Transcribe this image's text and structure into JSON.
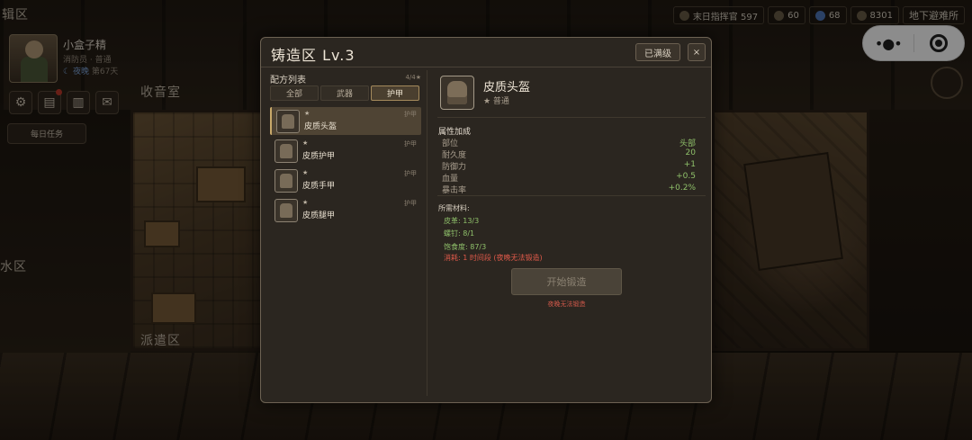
{
  "scene": {
    "room_labels": {
      "radio": "收音室",
      "dispatch": "派遣区",
      "water": "水区",
      "top_left": "辑区"
    }
  },
  "player": {
    "name": "小盒子精",
    "role": "消防员 · 普通",
    "period": "夜晚",
    "day": "第67天"
  },
  "hud": {
    "daily_tasks": "每日任务",
    "icons": [
      "gear-icon",
      "book-icon",
      "cards-icon",
      "mail-icon"
    ]
  },
  "resources": {
    "commander": "末日指挥官 597",
    "r2": "60",
    "r3": "68",
    "r4": "8301",
    "shelter": "地下避难所"
  },
  "capsule": {
    "more": "•●•"
  },
  "modal": {
    "title": "铸造区  Lv.3",
    "maxed": "已满级",
    "close": "×",
    "recipe_header": "配方列表",
    "recipe_count": "4/4★",
    "tabs": [
      "全部",
      "武器",
      "护甲"
    ],
    "active_tab": "护甲",
    "recipes": [
      {
        "star": "★",
        "name": "皮质头盔",
        "category": "护甲"
      },
      {
        "star": "★",
        "name": "皮质护甲",
        "category": "护甲"
      },
      {
        "star": "★",
        "name": "皮质手甲",
        "category": "护甲"
      },
      {
        "star": "★",
        "name": "皮质腿甲",
        "category": "护甲"
      }
    ],
    "detail": {
      "name": "皮质头盔",
      "rarity": "★ 普通",
      "attr_title": "属性加成",
      "attrs": [
        {
          "k": "部位",
          "v": "头部"
        },
        {
          "k": "耐久度",
          "v": "20"
        },
        {
          "k": "防御力",
          "v": "+1"
        },
        {
          "k": "血量",
          "v": "+0.5"
        },
        {
          "k": "暴击率",
          "v": "+0.2%"
        }
      ],
      "materials_title": "所需材料:",
      "materials": [
        "皮革: 13/3",
        "螺钉: 8/1"
      ],
      "satiety": "饱食度: 87/3",
      "cost": "消耗: 1 时间段 (夜晚无法锻造)",
      "forge_button": "开始锻造",
      "forge_note": "夜晚无法锻造"
    }
  }
}
